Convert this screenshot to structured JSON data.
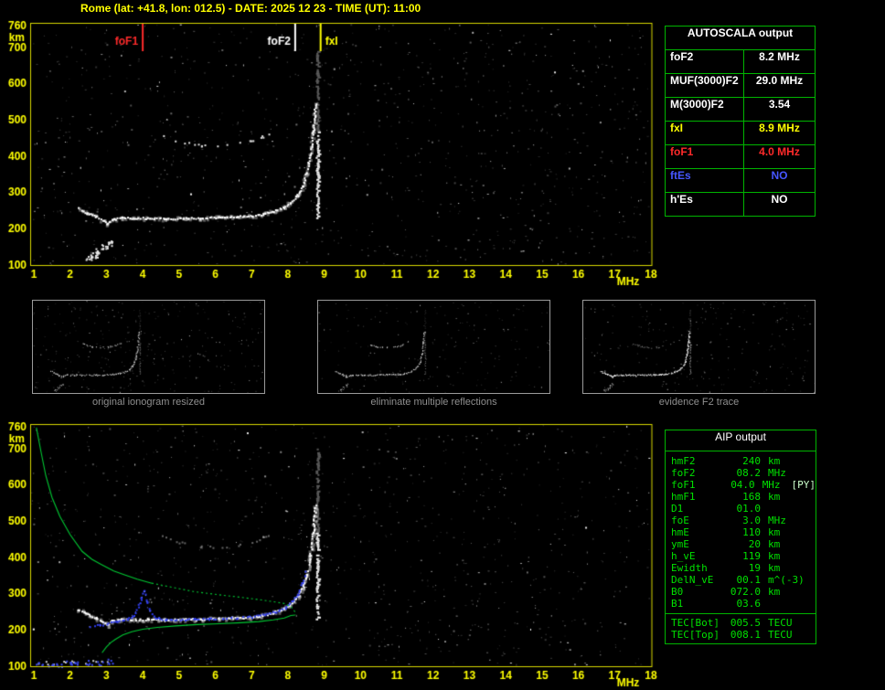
{
  "window": {
    "title": "Rome (lat: +41.8, lon: 012.5) - DATE: 2025 12 23 - TIME (UT): 11:00"
  },
  "colors": {
    "axis_yellow": "#ffff00",
    "border_yellow": "#d8d800",
    "table_green": "#00b400",
    "aip_green": "#00e000",
    "foF1_red": "#ff2a2a",
    "fxI_yellow": "#ffff00",
    "ftEs_blue": "#4656ff",
    "trace_white": "#ffffff",
    "profile_green": "#00c832",
    "restored_blue": "#2e3cf0",
    "caption_gray": "#8f8f8f"
  },
  "autoscala_table": {
    "title": "AUTOSCALA output",
    "rows": [
      {
        "label": "foF2",
        "value": "8.2 MHz",
        "color": "#ffffff"
      },
      {
        "label": "MUF(3000)F2",
        "value": "29.0 MHz",
        "color": "#ffffff"
      },
      {
        "label": "M(3000)F2",
        "value": "3.54",
        "color": "#ffffff"
      },
      {
        "label": "fxI",
        "value": "8.9 MHz",
        "color": "#ffff00"
      },
      {
        "label": "foF1",
        "value": "4.0 MHz",
        "color": "#ff2a2a"
      },
      {
        "label": "ftEs",
        "value": "NO",
        "color": "#4656ff"
      },
      {
        "label": "h'Es",
        "value": "NO",
        "color": "#ffffff"
      }
    ]
  },
  "thumbnails": [
    {
      "caption": "original ionogram resized"
    },
    {
      "caption": "eliminate multiple reflections"
    },
    {
      "caption": "evidence F2 trace"
    }
  ],
  "aip_table": {
    "title": "AIP output",
    "rows": [
      {
        "param": "hmF2",
        "value": "240",
        "unit": "km",
        "extra": ""
      },
      {
        "param": "foF2",
        "value": "08.2",
        "unit": "MHz",
        "extra": ""
      },
      {
        "param": "foF1",
        "value": "04.0",
        "unit": "MHz",
        "extra": "[PY]"
      },
      {
        "param": "hmF1",
        "value": "168",
        "unit": "km",
        "extra": ""
      },
      {
        "param": "D1",
        "value": "01.0",
        "unit": "",
        "extra": ""
      },
      {
        "param": "foE",
        "value": "3.0",
        "unit": "MHz",
        "extra": ""
      },
      {
        "param": "hmE",
        "value": "110",
        "unit": "km",
        "extra": ""
      },
      {
        "param": "ymE",
        "value": "20",
        "unit": "km",
        "extra": ""
      },
      {
        "param": "h_vE",
        "value": "119",
        "unit": "km",
        "extra": ""
      },
      {
        "param": "Ewidth",
        "value": "19",
        "unit": "km",
        "extra": ""
      },
      {
        "param": "DelN_vE",
        "value": "00.1",
        "unit": "m^(-3)",
        "extra": ""
      },
      {
        "param": "B0",
        "value": "072.0",
        "unit": "km",
        "extra": ""
      },
      {
        "param": "B1",
        "value": "03.6",
        "unit": "",
        "extra": ""
      }
    ],
    "tec_rows": [
      {
        "param": "TEC[Bot]",
        "value": "005.5",
        "unit": "TECU"
      },
      {
        "param": "TEC[Top]",
        "value": "008.1",
        "unit": "TECU"
      }
    ]
  },
  "chart_data": [
    {
      "id": "top_ionogram",
      "type": "scatter",
      "title": "Autoscaled ionogram (virtual height vs frequency)",
      "xlabel": "MHz",
      "ylabel": "km",
      "x_ticks": [
        1,
        2,
        3,
        4,
        5,
        6,
        7,
        8,
        9,
        10,
        11,
        12,
        13,
        14,
        15,
        16,
        17,
        18
      ],
      "y_ticks": [
        100,
        200,
        300,
        400,
        500,
        600,
        700,
        760
      ],
      "xlim": [
        1,
        18
      ],
      "ylim": [
        100,
        760
      ],
      "grid": false,
      "markers": [
        {
          "label": "foF1",
          "freq_mhz": 4.0,
          "color": "#ff2a2a",
          "label_side": "left"
        },
        {
          "label": "foF2",
          "freq_mhz": 8.2,
          "color": "#ffffff",
          "label_side": "left"
        },
        {
          "label": "fxI",
          "freq_mhz": 8.9,
          "color": "#ffff00",
          "label_side": "right"
        }
      ],
      "traces": {
        "f_trace": [
          [
            2.2,
            258
          ],
          [
            2.45,
            244
          ],
          [
            2.7,
            234
          ],
          [
            2.9,
            222
          ],
          [
            3.0,
            214
          ],
          [
            3.15,
            225
          ],
          [
            3.4,
            231
          ],
          [
            3.7,
            229
          ],
          [
            4.1,
            230
          ],
          [
            4.6,
            228
          ],
          [
            5.1,
            230
          ],
          [
            5.6,
            230
          ],
          [
            6.1,
            232
          ],
          [
            6.6,
            234
          ],
          [
            7.0,
            236
          ],
          [
            7.3,
            241
          ],
          [
            7.6,
            249
          ],
          [
            7.85,
            259
          ],
          [
            8.05,
            272
          ],
          [
            8.25,
            293
          ],
          [
            8.4,
            320
          ],
          [
            8.5,
            355
          ],
          [
            8.6,
            405
          ],
          [
            8.68,
            470
          ],
          [
            8.74,
            545
          ]
        ],
        "second_hop": [
          [
            4.55,
            458
          ],
          [
            4.9,
            445
          ],
          [
            5.25,
            437
          ],
          [
            5.6,
            431
          ],
          [
            5.95,
            429
          ],
          [
            6.3,
            431
          ],
          [
            6.65,
            436
          ],
          [
            7.0,
            444
          ],
          [
            7.3,
            455
          ],
          [
            7.55,
            468
          ]
        ],
        "e_patch": [
          [
            2.5,
            118
          ],
          [
            2.65,
            127
          ],
          [
            2.8,
            138
          ],
          [
            2.95,
            150
          ],
          [
            3.05,
            160
          ]
        ],
        "asymptote": {
          "freq_mhz": 8.8,
          "h_from_km": 230,
          "h_to_km": 700
        }
      }
    },
    {
      "id": "bottom_ionogram_with_profile",
      "type": "scatter",
      "title": "Ionogram with restored trace and electron density profile",
      "xlabel": "MHz",
      "ylabel": "km",
      "x_ticks": [
        1,
        2,
        3,
        4,
        5,
        6,
        7,
        8,
        9,
        10,
        11,
        12,
        13,
        14,
        15,
        16,
        17,
        18
      ],
      "y_ticks": [
        100,
        200,
        300,
        400,
        500,
        600,
        700,
        760
      ],
      "xlim": [
        1,
        18
      ],
      "ylim": [
        100,
        760
      ],
      "grid": false,
      "traces": {
        "restored_trace_blue": [
          [
            2.55,
            210
          ],
          [
            2.8,
            214
          ],
          [
            3.05,
            219
          ],
          [
            3.3,
            224
          ],
          [
            3.55,
            229
          ],
          [
            3.72,
            238
          ],
          [
            3.85,
            262
          ],
          [
            3.95,
            290
          ],
          [
            4.02,
            308
          ],
          [
            4.1,
            278
          ],
          [
            4.2,
            252
          ],
          [
            4.35,
            234
          ],
          [
            4.6,
            228
          ],
          [
            5.0,
            229
          ],
          [
            5.4,
            230
          ],
          [
            5.8,
            231
          ],
          [
            6.2,
            232
          ],
          [
            6.6,
            234
          ],
          [
            7.0,
            237
          ],
          [
            7.35,
            243
          ],
          [
            7.65,
            251
          ],
          [
            7.9,
            262
          ],
          [
            8.1,
            278
          ],
          [
            8.25,
            300
          ],
          [
            8.38,
            330
          ],
          [
            8.45,
            360
          ]
        ],
        "profile_topside_green": [
          [
            1.07,
            758
          ],
          [
            1.2,
            690
          ],
          [
            1.33,
            625
          ],
          [
            1.5,
            565
          ],
          [
            1.72,
            512
          ],
          [
            2.0,
            462
          ],
          [
            2.33,
            416
          ],
          [
            2.6,
            394
          ],
          [
            2.85,
            380
          ],
          [
            3.2,
            362
          ],
          [
            3.5,
            351
          ],
          [
            3.85,
            339
          ],
          [
            4.25,
            328
          ],
          [
            4.8,
            317
          ],
          [
            5.4,
            305
          ],
          [
            6.1,
            296
          ],
          [
            6.8,
            288
          ],
          [
            7.4,
            280
          ],
          [
            7.9,
            272
          ],
          [
            8.1,
            262
          ],
          [
            8.2,
            248
          ],
          [
            8.22,
            241
          ]
        ],
        "profile_bottomside_green": [
          [
            2.88,
            136
          ],
          [
            3.0,
            152
          ],
          [
            3.12,
            164
          ],
          [
            3.25,
            173
          ],
          [
            3.45,
            185
          ],
          [
            3.7,
            194
          ],
          [
            4.0,
            201
          ],
          [
            4.4,
            206
          ],
          [
            4.9,
            210
          ],
          [
            5.5,
            214
          ],
          [
            6.1,
            216
          ],
          [
            6.7,
            219
          ],
          [
            7.2,
            222
          ],
          [
            7.6,
            227
          ],
          [
            7.9,
            232
          ],
          [
            8.08,
            239
          ],
          [
            8.2,
            240
          ]
        ],
        "blue_e_dots": [
          [
            1.15,
            104
          ],
          [
            1.45,
            107
          ],
          [
            1.7,
            103
          ],
          [
            1.95,
            109
          ],
          [
            2.2,
            105
          ],
          [
            2.5,
            111
          ],
          [
            2.8,
            108
          ],
          [
            3.1,
            114
          ]
        ],
        "bottom_band_white": [
          [
            1.05,
            108
          ],
          [
            2.0,
            110
          ],
          [
            3.05,
            112
          ]
        ]
      }
    }
  ]
}
